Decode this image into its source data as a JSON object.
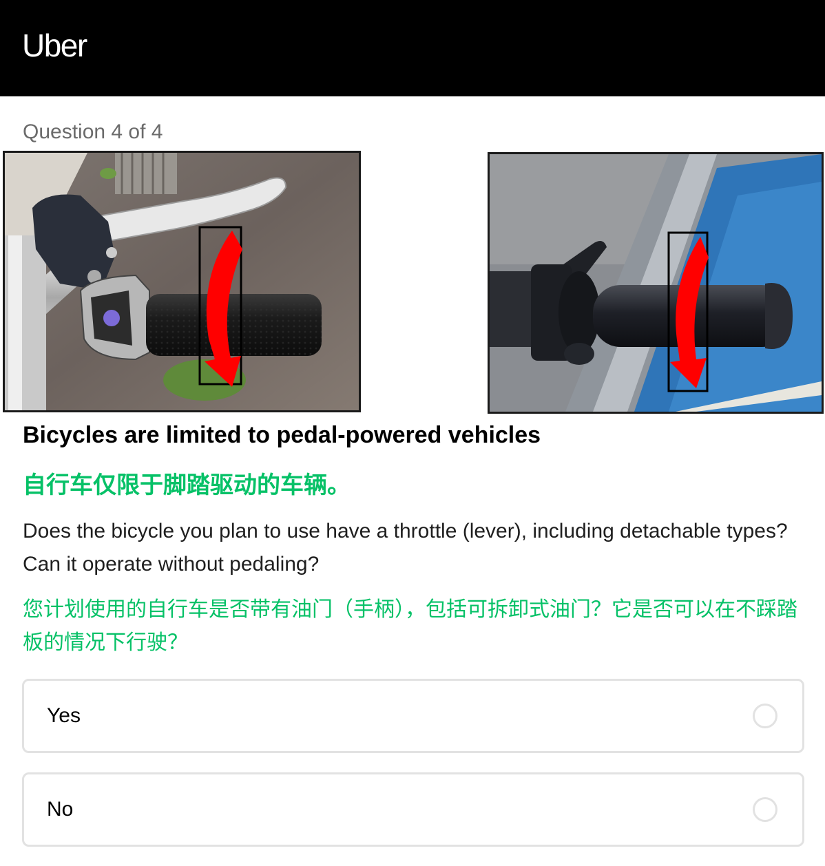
{
  "header": {
    "logo_text": "Uber",
    "background": "#000000"
  },
  "progress": {
    "label": "Question 4 of 4"
  },
  "images": {
    "left": {
      "icon": "throttle-grip-rotation-photo"
    },
    "right": {
      "icon": "throttle-grip-rotation-photo"
    }
  },
  "question": {
    "title_en": "Bicycles are limited to pedal-powered vehicles",
    "title_zh": "自行车仅限于脚踏驱动的车辆。",
    "body_en": "Does the bicycle you plan to use have a throttle (lever), including detachable types? Can it operate without pedaling?",
    "body_zh": "您计划使用的自行车是否带有油门（手柄），包括可拆卸式油门？它是否可以在不踩踏板的情况下行驶？"
  },
  "options": [
    {
      "label": "Yes",
      "selected": false
    },
    {
      "label": "No",
      "selected": false
    }
  ],
  "colors": {
    "accent_green": "#06c167",
    "border": "#e2e2e2",
    "arrow_red": "#ff0000"
  }
}
